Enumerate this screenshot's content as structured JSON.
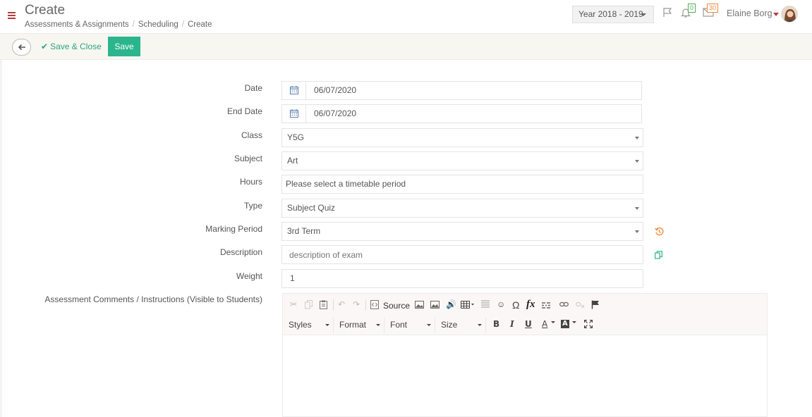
{
  "header": {
    "title": "Create",
    "breadcrumb": [
      "Assessments & Assignments",
      "Scheduling",
      "Create"
    ],
    "year_select": "Year 2018 - 2019",
    "notifications_count": "0",
    "messages_count": "30",
    "user_name": "Elaine Borg"
  },
  "toolbar": {
    "save_close_label": "Save & Close",
    "save_label": "Save"
  },
  "form": {
    "date": {
      "label": "Date",
      "value": "06/07/2020"
    },
    "end_date": {
      "label": "End Date",
      "value": "06/07/2020"
    },
    "class": {
      "label": "Class",
      "value": "Y5G"
    },
    "subject": {
      "label": "Subject",
      "value": "Art"
    },
    "hours": {
      "label": "Hours",
      "value": "Please select a timetable period"
    },
    "type": {
      "label": "Type",
      "value": "Subject Quiz"
    },
    "marking_period": {
      "label": "Marking Period",
      "value": "3rd Term"
    },
    "description": {
      "label": "Description",
      "placeholder": "description of exam",
      "value": ""
    },
    "weight": {
      "label": "Weight",
      "value": "1"
    },
    "comments": {
      "label": "Assessment Comments / Instructions (Visible to Students)"
    }
  },
  "editor": {
    "source_label": "Source",
    "styles_label": "Styles",
    "format_label": "Format",
    "font_label": "Font",
    "size_label": "Size",
    "bold_label": "B",
    "italic_label": "I",
    "underline_label": "U",
    "text_color_label": "A",
    "bg_color_label": "A",
    "omega_label": "Ω",
    "fx_label": "fx"
  },
  "colors": {
    "accent": "#2bb58c",
    "brand_red": "#b53c3c",
    "badge_green": "#4caf50",
    "badge_orange": "#f08c3c"
  }
}
